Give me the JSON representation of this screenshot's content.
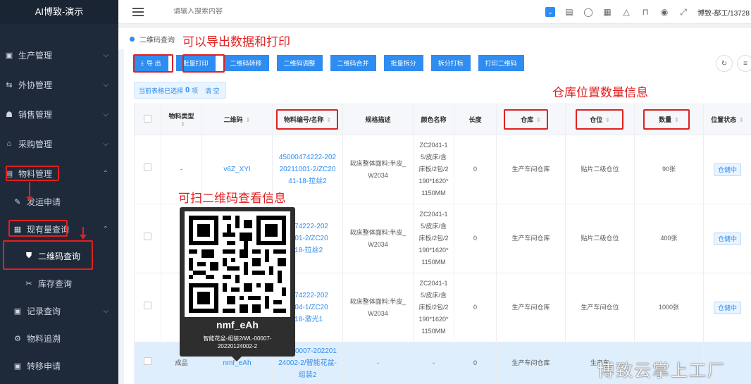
{
  "app": {
    "title": "AI博致-演示"
  },
  "topbar": {
    "search_placeholder": "请输入搜索内容",
    "user": "博致-部工/13728"
  },
  "sidebar": {
    "items": [
      {
        "label": "生产管理",
        "icon": "monitor-icon"
      },
      {
        "label": "外协管理",
        "icon": "swap-icon"
      },
      {
        "label": "销售管理",
        "icon": "users-icon"
      },
      {
        "label": "采购管理",
        "icon": "bag-icon"
      },
      {
        "label": "物料管理",
        "icon": "box-icon"
      },
      {
        "label": "发运申请",
        "icon": "edit-icon"
      },
      {
        "label": "现有量查询",
        "icon": "table-icon"
      },
      {
        "label": "二维码查询",
        "icon": "shield-icon"
      },
      {
        "label": "库存查询",
        "icon": "tools-icon"
      },
      {
        "label": "记录查询",
        "icon": "doc-icon"
      },
      {
        "label": "物料追溯",
        "icon": "gear-icon"
      },
      {
        "label": "转移申请",
        "icon": "image-icon"
      }
    ]
  },
  "tab": {
    "label": "二维码查询"
  },
  "annotations": {
    "export_print": "可以导出数据和打印",
    "location_qty": "仓库位置数量信息",
    "scan_qr": "可扫二维码查看信息"
  },
  "toolbar": {
    "buttons": [
      "导 出",
      "批量打印",
      "二维码转移",
      "二维码调整",
      "二维码合并",
      "批量拆分",
      "拆分打标",
      "打印二维码"
    ]
  },
  "selection": {
    "prefix": "当前表格已选择",
    "count": "0",
    "suffix": "项",
    "clear": "清 空"
  },
  "table": {
    "columns": [
      "物料类型",
      "二维码",
      "物料编号/名称",
      "规格描述",
      "颜色名称",
      "长度",
      "仓库",
      "仓位",
      "数量",
      "位置状态"
    ],
    "rows": [
      {
        "type": "-",
        "qrcode": "v6Z_XYI",
        "material": [
          "45000474222-202",
          "20211001-2/ZC20",
          "41-18-拉丝2"
        ],
        "spec": [
          "软床整体面料:半皮_",
          "W2034"
        ],
        "color": [
          "ZC2041-1",
          "5/皮床/含",
          "床板/2包/2",
          "190*1620*",
          "1150MM"
        ],
        "length": "0",
        "warehouse": "生产车间仓库",
        "location": "贴片二级仓位",
        "qty": "90张",
        "status": "仓储中"
      },
      {
        "type": "",
        "qrcode": "",
        "material": [
          "0474222-202",
          "1001-2/ZC20",
          "-18-拉丝2"
        ],
        "spec": [
          "软床整体面料:半皮_",
          "W2034"
        ],
        "color": [
          "ZC2041-1",
          "5/皮床/含",
          "床板/2包/2",
          "190*1620*",
          "1150MM"
        ],
        "length": "0",
        "warehouse": "生产车间仓库",
        "location": "贴片二级仓位",
        "qty": "400张",
        "status": "仓储中"
      },
      {
        "type": "",
        "qrcode": "",
        "material": [
          "0474222-202",
          "8004-1/ZC20",
          "-18-激光1"
        ],
        "spec": [
          "软床整体面料:半皮_",
          "W2034"
        ],
        "color": [
          "ZC2041-1",
          "5/皮床/含",
          "床板/2包/2",
          "190*1620*",
          "1150MM"
        ],
        "length": "0",
        "warehouse": "生产车间仓库",
        "location": "生产车间仓位",
        "qty": "1000张",
        "status": "仓储中"
      },
      {
        "type": "成品",
        "qrcode": "nmf_eAh",
        "material": [
          "WL-00007-202201",
          "24002-2/智能花盆-",
          "组装2"
        ],
        "spec": [
          "-"
        ],
        "color": [
          "-"
        ],
        "length": "0",
        "warehouse": "生产车间仓库",
        "location": "生产车",
        "qty": "",
        "status": ""
      }
    ]
  },
  "qr_popup": {
    "title": "nmf_eAh",
    "sub1": "智能花盆-组装2/WL-00007-",
    "sub2": "20220124002-2"
  },
  "watermark": "博致云掌上工厂"
}
